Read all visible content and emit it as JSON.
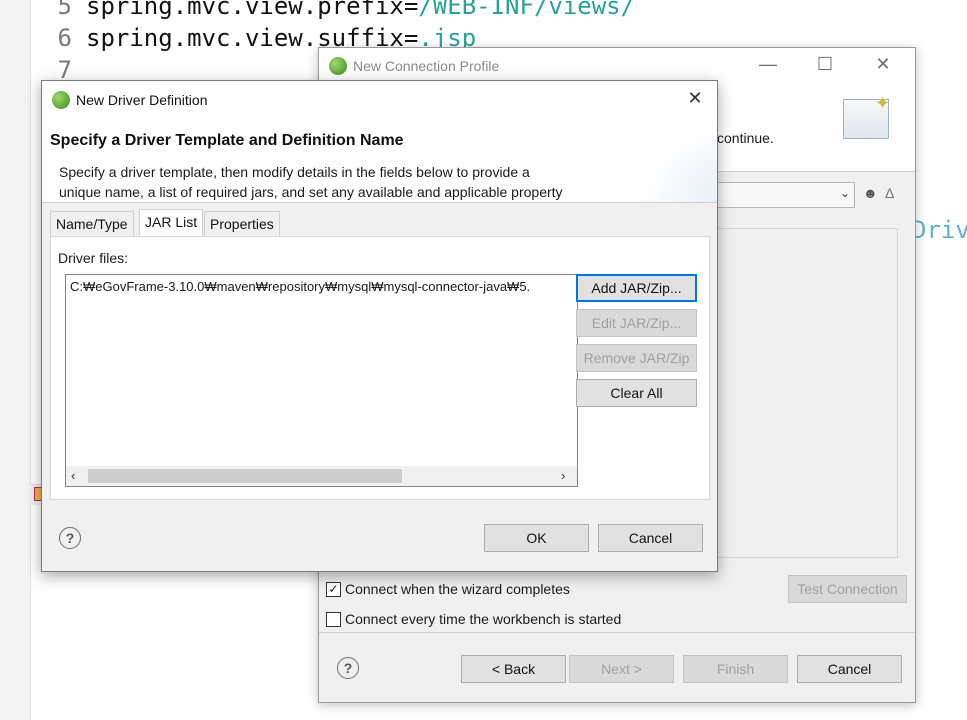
{
  "editor": {
    "lines": [
      {
        "num": "5",
        "key": "spring.mvc.view.prefix=",
        "value": "/WEB-INF/views/"
      },
      {
        "num": "6",
        "key": "spring.mvc.view.suffix=",
        "value": ".jsp"
      },
      {
        "num": "7",
        "key": "",
        "value": ""
      }
    ],
    "right_fragment": "Driv"
  },
  "profile_dialog": {
    "title": "New Connection Profile",
    "banner_tail": "continue.",
    "connect_on_complete": {
      "label": "Connect when the wizard completes",
      "checked": true
    },
    "connect_on_start": {
      "label": "Connect every time the workbench is started",
      "checked": false
    },
    "test_connection": "Test Connection",
    "buttons": {
      "back": "< Back",
      "next": "Next >",
      "finish": "Finish",
      "cancel": "Cancel"
    },
    "help": "?"
  },
  "driver_dialog": {
    "title": "New Driver Definition",
    "heading": "Specify a Driver Template and Definition Name",
    "description_line1": "Specify a driver template, then modify details in the fields below to provide a",
    "description_line2": "unique name, a list of required jars, and set any available and applicable property",
    "tabs": [
      "Name/Type",
      "JAR List",
      "Properties"
    ],
    "active_tab": "JAR List",
    "driver_files_label": "Driver files:",
    "jar_files": [
      "C:₩eGovFrame-3.10.0₩maven₩repository₩mysql₩mysql-connector-java₩5."
    ],
    "buttons": {
      "add": "Add JAR/Zip...",
      "edit": "Edit JAR/Zip...",
      "remove": "Remove JAR/Zip",
      "clear": "Clear All",
      "ok": "OK",
      "cancel": "Cancel"
    },
    "help": "?"
  },
  "colors": {
    "accent": "#0078d7",
    "code_value": "#2aa198",
    "dialog_bg": "#f0f0f0"
  }
}
